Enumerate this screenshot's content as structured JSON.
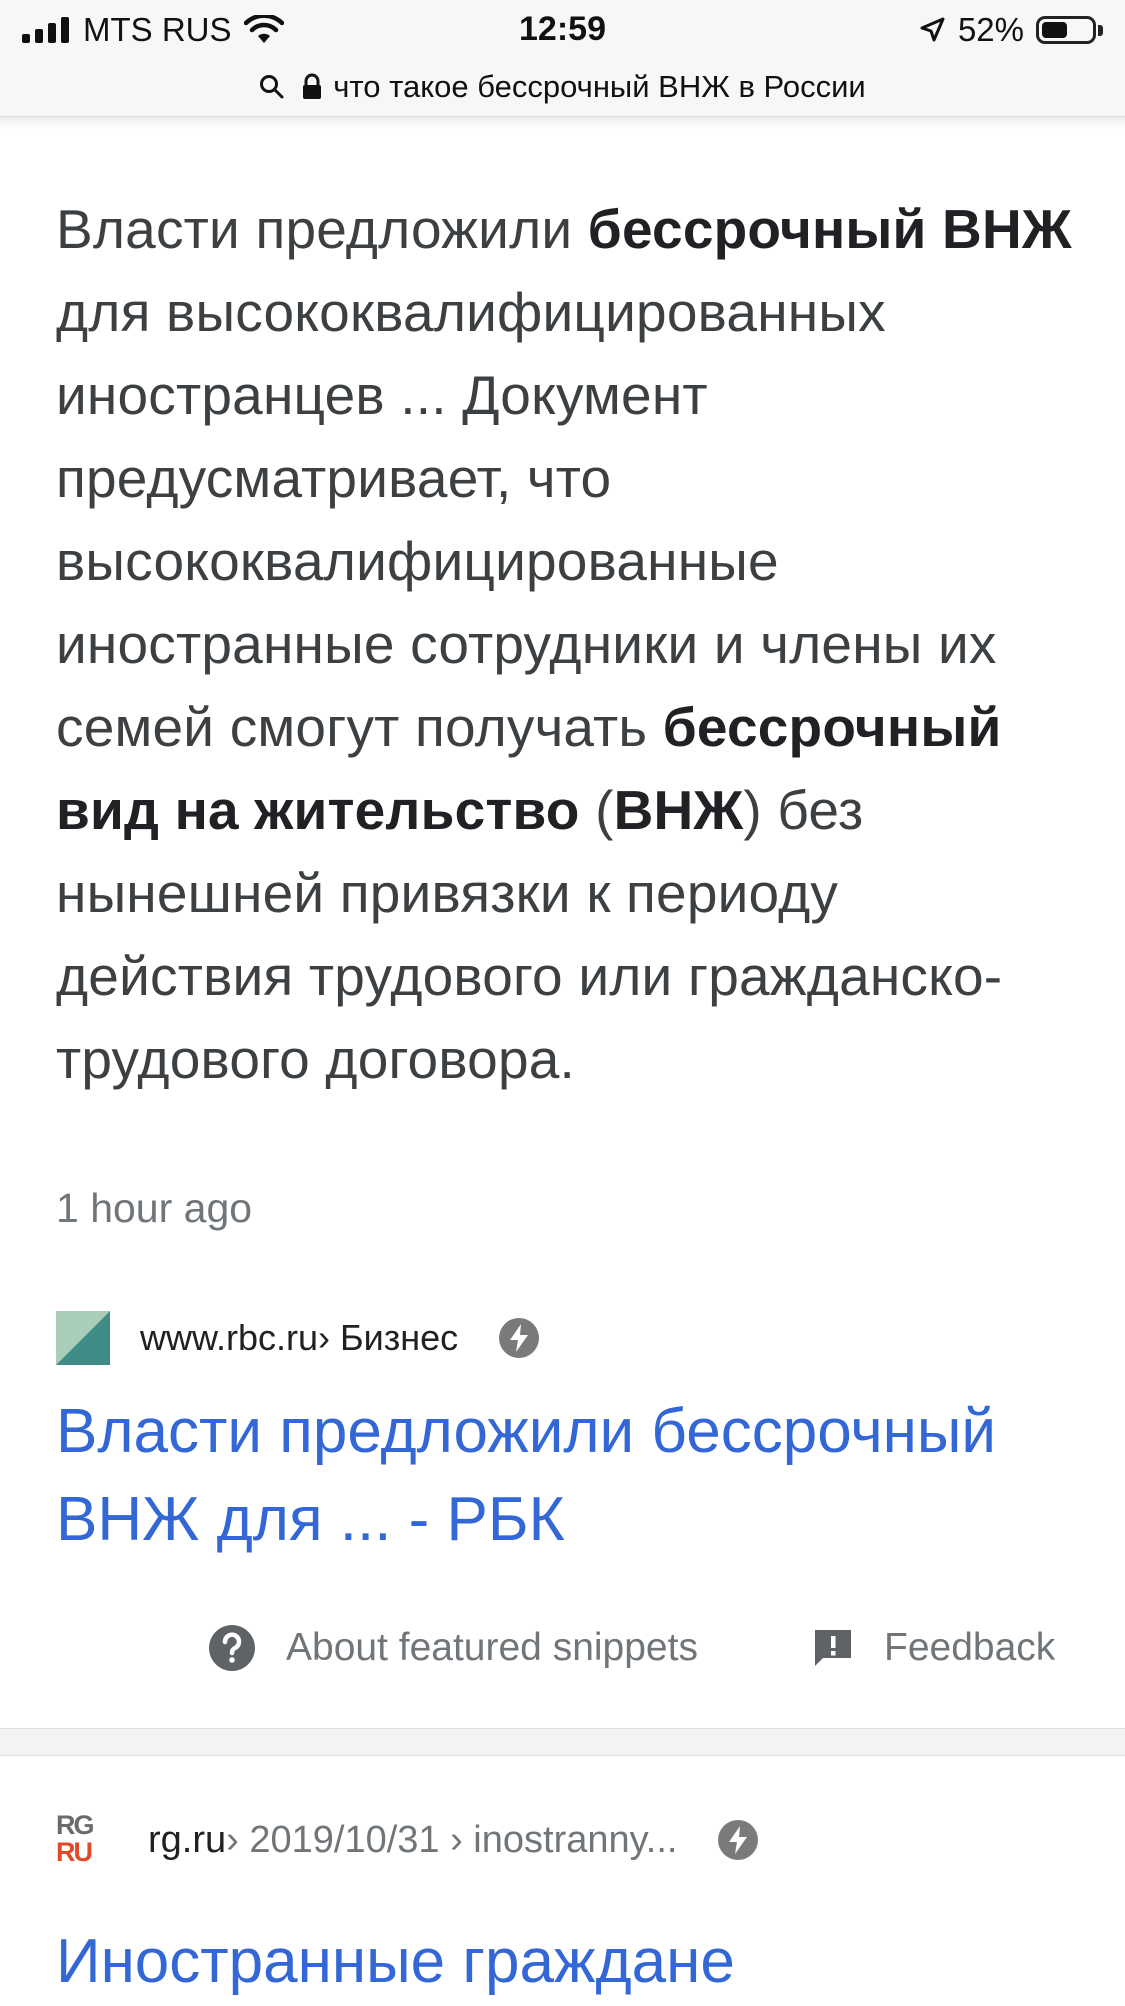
{
  "status_bar": {
    "carrier": "MTS RUS",
    "time": "12:59",
    "battery": "52%",
    "battery_level": 0.52
  },
  "url_bar": {
    "query": "что такое бессрочный ВНЖ в России"
  },
  "snippet": {
    "parts": [
      {
        "t": "Власти предложили ",
        "b": false
      },
      {
        "t": "бессрочный ВНЖ",
        "b": true
      },
      {
        "t": " для высококвалифицированных иностранцев ... Документ предусматривает, что высококвалифицированные иностранные сотрудники и члены их семей смогут получать ",
        "b": false
      },
      {
        "t": "бессрочный вид на жительство",
        "b": true
      },
      {
        "t": " (",
        "b": false
      },
      {
        "t": "ВНЖ",
        "b": true
      },
      {
        "t": ") без нынешней привязки к периоду действия трудового или гражданско-трудового договора.",
        "b": false
      }
    ],
    "time_ago": "1 hour ago"
  },
  "result1": {
    "url": "www.rbc.ru",
    "crumb": " › Бизнес",
    "title": "Власти предложили бессрочный ВНЖ для ... - РБК"
  },
  "snippet_actions": {
    "about": "About featured snippets",
    "feedback": "Feedback"
  },
  "result2": {
    "favicon_top": "RG",
    "favicon_bottom": "RU",
    "url": "rg.ru",
    "crumb": " › 2019/10/31 › inostranny...",
    "title": "Иностранные граждане"
  },
  "colors": {
    "link": "#3367d6",
    "text": "#3c4043",
    "muted": "#70757a"
  }
}
